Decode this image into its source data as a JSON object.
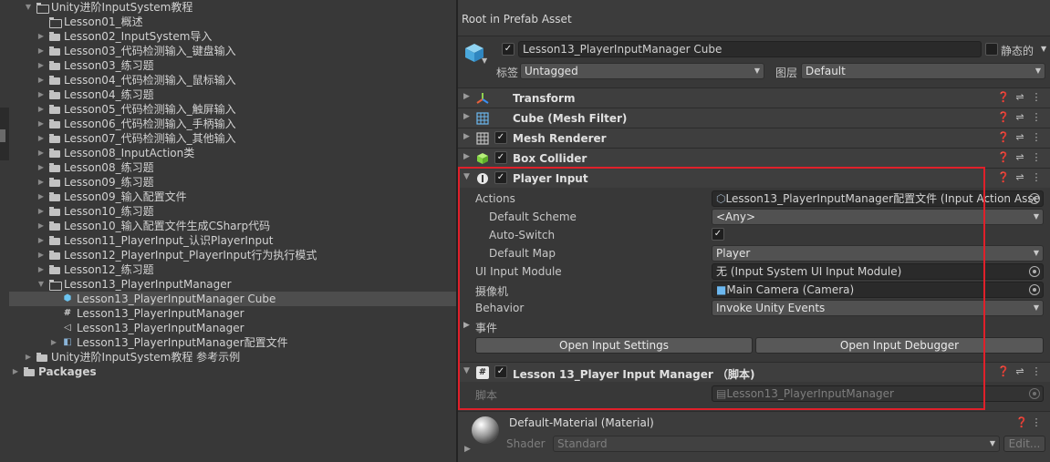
{
  "project": {
    "items": [
      {
        "label": "Unity进阶InputSystem教程",
        "icon": "folder-open-icon",
        "indent": 0,
        "expanded": true
      },
      {
        "label": "Lesson01_概述",
        "icon": "folder-open-icon",
        "indent": 1,
        "expanded": false,
        "no_arrow": true
      },
      {
        "label": "Lesson02_InputSystem导入",
        "icon": "folder-icon",
        "indent": 1
      },
      {
        "label": "Lesson03_代码检测输入_键盘输入",
        "icon": "folder-icon",
        "indent": 1
      },
      {
        "label": "Lesson03_练习题",
        "icon": "folder-icon",
        "indent": 1
      },
      {
        "label": "Lesson04_代码检测输入_鼠标输入",
        "icon": "folder-icon",
        "indent": 1
      },
      {
        "label": "Lesson04_练习题",
        "icon": "folder-icon",
        "indent": 1
      },
      {
        "label": "Lesson05_代码检测输入_触屏输入",
        "icon": "folder-icon",
        "indent": 1
      },
      {
        "label": "Lesson06_代码检测输入_手柄输入",
        "icon": "folder-icon",
        "indent": 1
      },
      {
        "label": "Lesson07_代码检测输入_其他输入",
        "icon": "folder-icon",
        "indent": 1
      },
      {
        "label": "Lesson08_InputAction类",
        "icon": "folder-icon",
        "indent": 1
      },
      {
        "label": "Lesson08_练习题",
        "icon": "folder-icon",
        "indent": 1
      },
      {
        "label": "Lesson09_练习题",
        "icon": "folder-icon",
        "indent": 1
      },
      {
        "label": "Lesson09_输入配置文件",
        "icon": "folder-icon",
        "indent": 1
      },
      {
        "label": "Lesson10_练习题",
        "icon": "folder-icon",
        "indent": 1
      },
      {
        "label": "Lesson10_输入配置文件生成CSharp代码",
        "icon": "folder-icon",
        "indent": 1
      },
      {
        "label": "Lesson11_PlayerInput_认识PlayerInput",
        "icon": "folder-icon",
        "indent": 1
      },
      {
        "label": "Lesson12_PlayerInput_PlayerInput行为执行模式",
        "icon": "folder-icon",
        "indent": 1
      },
      {
        "label": "Lesson12_练习题",
        "icon": "folder-icon",
        "indent": 1
      },
      {
        "label": "Lesson13_PlayerInputManager",
        "icon": "folder-open-icon",
        "indent": 1,
        "expanded": true
      },
      {
        "label": "Lesson13_PlayerInputManager Cube",
        "icon": "prefab-cube-icon",
        "indent": 2,
        "selected": true
      },
      {
        "label": "Lesson13_PlayerInputManager",
        "icon": "csharp-script-icon",
        "indent": 2
      },
      {
        "label": "Lesson13_PlayerInputManager",
        "icon": "scene-icon",
        "indent": 2
      },
      {
        "label": "Lesson13_PlayerInputManager配置文件",
        "icon": "input-actions-icon",
        "indent": 2,
        "has_arrow": true
      },
      {
        "label": "Unity进阶InputSystem教程 参考示例",
        "icon": "folder-icon",
        "indent": 0
      },
      {
        "label": "Packages",
        "icon": "folder-icon",
        "indent": -1,
        "bold": true
      }
    ]
  },
  "inspector": {
    "header_title": "Root in Prefab Asset",
    "object_name": "Lesson13_PlayerInputManager Cube",
    "static_label": "静态的",
    "tag_label": "标签",
    "tag_value": "Untagged",
    "layer_label": "图层",
    "layer_value": "Default",
    "components": {
      "transform": "Transform",
      "mesh_filter": "Cube (Mesh Filter)",
      "mesh_renderer": "Mesh Renderer",
      "box_collider": "Box Collider",
      "player_input": "Player Input",
      "script": "Lesson 13_Player Input Manager  （脚本)"
    },
    "player_input": {
      "actions_label": "Actions",
      "actions_value": "Lesson13_PlayerInputManager配置文件 (Input Action Asse",
      "default_scheme_label": "Default Scheme",
      "default_scheme_value": "<Any>",
      "auto_switch_label": "Auto-Switch",
      "default_map_label": "Default Map",
      "default_map_value": "Player",
      "ui_input_module_label": "UI Input Module",
      "ui_input_module_value": "无 (Input System UI Input Module)",
      "camera_label": "摄像机",
      "camera_value": "Main Camera (Camera)",
      "behavior_label": "Behavior",
      "behavior_value": "Invoke Unity Events",
      "events_label": "事件",
      "open_settings": "Open Input Settings",
      "open_debugger": "Open Input Debugger"
    },
    "script": {
      "label": "脚本",
      "value": "Lesson13_PlayerInputManager"
    },
    "material": {
      "name": "Default-Material (Material)",
      "shader_label": "Shader",
      "shader_value": "Standard",
      "edit_label": "Edit..."
    }
  }
}
